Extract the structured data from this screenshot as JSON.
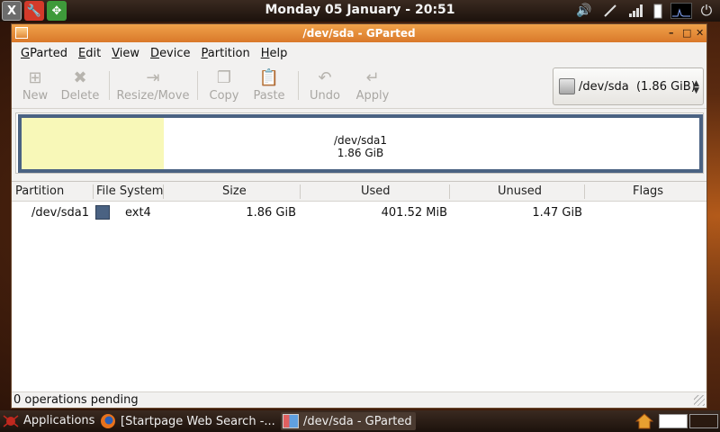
{
  "top_panel": {
    "clock": "Monday 05 January - 20:51",
    "launchers": [
      "x-icon",
      "wrench-icon",
      "compass-icon"
    ],
    "tray": [
      "volume-icon",
      "network-icon",
      "signal-icon",
      "battery-icon",
      "monitor-icon",
      "power-icon"
    ]
  },
  "window": {
    "title": "/dev/sda - GParted",
    "controls": {
      "minimize": "–",
      "maximize": "□",
      "close": "✕"
    }
  },
  "menu": [
    {
      "label": "GParted",
      "mnemonic_index": 0
    },
    {
      "label": "Edit",
      "mnemonic_index": 0
    },
    {
      "label": "View",
      "mnemonic_index": 0
    },
    {
      "label": "Device",
      "mnemonic_index": 0
    },
    {
      "label": "Partition",
      "mnemonic_index": 0
    },
    {
      "label": "Help",
      "mnemonic_index": 0
    }
  ],
  "toolbar": {
    "new": "New",
    "delete": "Delete",
    "resize_move": "Resize/Move",
    "copy": "Copy",
    "paste": "Paste",
    "undo": "Undo",
    "apply": "Apply",
    "device": "/dev/sda  (1.86 GiB)"
  },
  "disk_map": {
    "partition": "/dev/sda1",
    "size": "1.86 GiB",
    "used_fraction": 0.21,
    "colors": {
      "border": "#4a6282",
      "used": "#f8f8b8"
    }
  },
  "table": {
    "headers": {
      "partition": "Partition",
      "filesystem": "File System",
      "size": "Size",
      "used": "Used",
      "unused": "Unused",
      "flags": "Flags"
    },
    "rows": [
      {
        "partition": "/dev/sda1",
        "filesystem": "ext4",
        "size": "1.86 GiB",
        "used": "401.52 MiB",
        "unused": "1.47 GiB",
        "flags": ""
      }
    ]
  },
  "status": "0 operations pending",
  "bottom_panel": {
    "applications": "Applications",
    "tasks": [
      {
        "label": "[Startpage Web Search -..."
      },
      {
        "label": "/dev/sda - GParted"
      }
    ]
  }
}
